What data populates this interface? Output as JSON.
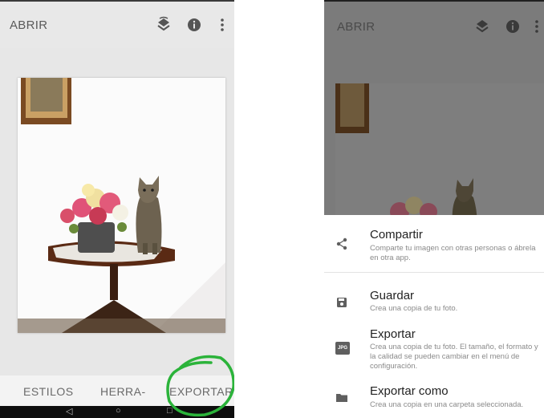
{
  "left": {
    "header": {
      "title": "ABRIR"
    },
    "icons": [
      "layers-icon",
      "info-icon",
      "more-vert-icon"
    ],
    "tabs": [
      {
        "label": "ESTILOS"
      },
      {
        "label": "HERRA-"
      },
      {
        "label": "EXPORTAR"
      }
    ],
    "nav": {
      "back": "◁",
      "home": "○",
      "recents": "□"
    }
  },
  "right": {
    "header": {
      "title": "ABRIR"
    },
    "menu": [
      {
        "icon": "share-icon",
        "label": "Compartir",
        "sub": "Comparte tu imagen con otras personas o ábrela en otra app."
      },
      {
        "icon": "save-icon",
        "label": "Guardar",
        "sub": "Crea una copia de tu foto."
      },
      {
        "icon": "jpg-icon",
        "label": "Exportar",
        "sub": "Crea una copia de tu foto. El tamaño, el formato y la calidad se pueden cambiar en el menú de configuración.",
        "badge": "JPG"
      },
      {
        "icon": "folder-icon",
        "label": "Exportar como",
        "sub": "Crea una copia en una carpeta seleccionada."
      }
    ]
  },
  "colors": {
    "annotation": "#2bb33a",
    "dim_overlay": "#7b7b7b"
  }
}
